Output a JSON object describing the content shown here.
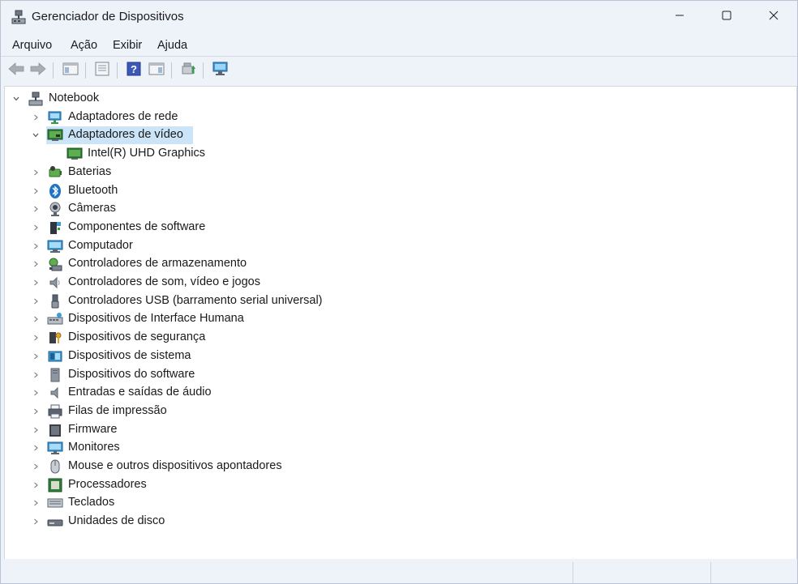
{
  "window": {
    "title": "Gerenciador de Dispositivos",
    "controls": [
      "minimize",
      "maximize",
      "close"
    ]
  },
  "menu": {
    "items": [
      "Arquivo",
      "Ação",
      "Exibir",
      "Ajuda"
    ]
  },
  "toolbar": {
    "buttons": [
      "back-icon",
      "forward-icon",
      "console-tree-icon",
      "properties-icon",
      "help-icon",
      "action-pane-icon",
      "update-driver-icon",
      "scan-hardware-icon"
    ]
  },
  "tree": {
    "root": "Notebook",
    "categories": [
      {
        "label": "Adaptadores de rede",
        "icon": "network-adapter-icon",
        "expanded": false
      },
      {
        "label": "Adaptadores de vídeo",
        "icon": "display-adapter-icon",
        "expanded": true,
        "selected": true,
        "children": [
          "Intel(R) UHD Graphics"
        ]
      },
      {
        "label": "Baterias",
        "icon": "battery-icon",
        "expanded": false
      },
      {
        "label": "Bluetooth",
        "icon": "bluetooth-icon",
        "expanded": false
      },
      {
        "label": "Câmeras",
        "icon": "camera-icon",
        "expanded": false
      },
      {
        "label": "Componentes de software",
        "icon": "software-component-icon",
        "expanded": false
      },
      {
        "label": "Computador",
        "icon": "computer-icon",
        "expanded": false
      },
      {
        "label": "Controladores de armazenamento",
        "icon": "storage-controller-icon",
        "expanded": false
      },
      {
        "label": "Controladores de som, vídeo e jogos",
        "icon": "speaker-icon",
        "expanded": false
      },
      {
        "label": "Controladores USB (barramento serial universal)",
        "icon": "usb-icon",
        "expanded": false
      },
      {
        "label": "Dispositivos de Interface Humana",
        "icon": "hid-icon",
        "expanded": false
      },
      {
        "label": "Dispositivos de segurança",
        "icon": "security-key-icon",
        "expanded": false
      },
      {
        "label": "Dispositivos de sistema",
        "icon": "system-device-icon",
        "expanded": false
      },
      {
        "label": "Dispositivos do software",
        "icon": "software-device-icon",
        "expanded": false
      },
      {
        "label": "Entradas e saídas de áudio",
        "icon": "audio-io-icon",
        "expanded": false
      },
      {
        "label": "Filas de impressão",
        "icon": "printer-icon",
        "expanded": false
      },
      {
        "label": "Firmware",
        "icon": "firmware-icon",
        "expanded": false
      },
      {
        "label": "Monitores",
        "icon": "monitor-icon",
        "expanded": false
      },
      {
        "label": "Mouse e outros dispositivos apontadores",
        "icon": "mouse-icon",
        "expanded": false
      },
      {
        "label": "Processadores",
        "icon": "processor-icon",
        "expanded": false
      },
      {
        "label": "Teclados",
        "icon": "keyboard-icon",
        "expanded": false
      },
      {
        "label": "Unidades de disco",
        "icon": "disk-drive-icon",
        "expanded": false
      }
    ]
  },
  "colors": {
    "window_bg": "#eef2f9",
    "tree_bg": "#ffffff",
    "selection": "#cce4f7",
    "accent": "#1e73c8"
  }
}
